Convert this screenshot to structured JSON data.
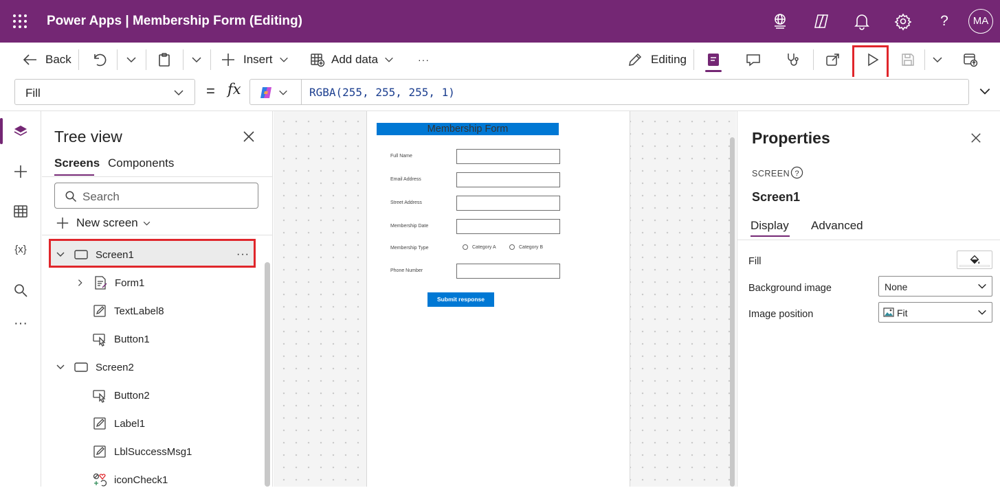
{
  "appbar": {
    "title": "Power Apps  |  Membership Form (Editing)",
    "avatar_initials": "MA",
    "icons": [
      "waffle-icon",
      "environment-icon",
      "copilot-icon",
      "bell-icon",
      "gear-icon",
      "help-icon"
    ],
    "color": "#742774"
  },
  "command_bar": {
    "back_label": "Back",
    "insert_label": "Insert",
    "add_data_label": "Add data",
    "more_label": "···",
    "editing_label": "Editing"
  },
  "formula_bar": {
    "property": "Fill",
    "equals": "=",
    "fx": "fx",
    "formula": "RGBA(255, 255, 255, 1)"
  },
  "tree_view": {
    "title": "Tree view",
    "tabs": [
      "Screens",
      "Components"
    ],
    "search_placeholder": "Search",
    "new_screen_label": "New screen",
    "nodes": [
      {
        "label": "Screen1",
        "type": "screen",
        "expanded": true,
        "selected": true
      },
      {
        "label": "Form1",
        "type": "form"
      },
      {
        "label": "TextLabel8",
        "type": "label"
      },
      {
        "label": "Button1",
        "type": "button"
      },
      {
        "label": "Screen2",
        "type": "screen",
        "expanded": true
      },
      {
        "label": "Button2",
        "type": "button"
      },
      {
        "label": "Label1",
        "type": "label"
      },
      {
        "label": "LblSuccessMsg1",
        "type": "label"
      },
      {
        "label": "iconCheck1",
        "type": "icon"
      }
    ]
  },
  "canvas": {
    "form_title": "Membership Form",
    "fields": [
      "Full Name",
      "Email Address",
      "Street Address",
      "Membership Date",
      "Membership Type",
      "Phone Number"
    ],
    "radio_options": [
      "Category A",
      "Category B"
    ],
    "submit_label": "Submit response",
    "accent": "#0078d4"
  },
  "properties": {
    "title": "Properties",
    "kind": "SCREEN",
    "name": "Screen1",
    "tabs": [
      "Display",
      "Advanced"
    ],
    "rows": [
      {
        "label": "Fill",
        "value": ""
      },
      {
        "label": "Background image",
        "value": "None"
      },
      {
        "label": "Image position",
        "value": "Fit"
      }
    ]
  },
  "highlight_color": "#e0262b"
}
